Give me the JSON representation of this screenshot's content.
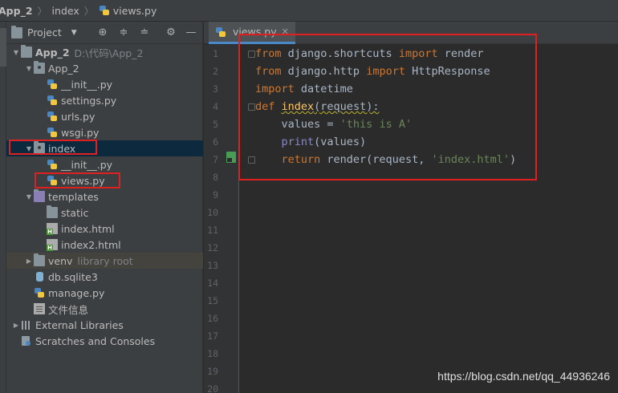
{
  "breadcrumb": {
    "items": [
      "App_2",
      "index",
      "views.py"
    ]
  },
  "project_panel": {
    "title": "Project",
    "toolbar_icons": [
      "target-icon",
      "expand-all-icon",
      "collapse-all-icon",
      "gear-icon",
      "minimize-icon"
    ]
  },
  "tree": {
    "root_name": "App_2",
    "root_path": "D:\\代码\\App_2",
    "app2_folder": "App_2",
    "app2_init": "__init__.py",
    "app2_settings": "settings.py",
    "app2_urls": "urls.py",
    "app2_wsgi": "wsgi.py",
    "index_folder": "index",
    "index_init": "__init__.py",
    "index_views": "views.py",
    "templates_folder": "templates",
    "static_folder": "static",
    "index_html": "index.html",
    "index2_html": "index2.html",
    "venv_folder": "venv",
    "venv_hint": "library root",
    "db_file": "db.sqlite3",
    "manage_file": "manage.py",
    "info_file": "文件信息",
    "external_libraries": "External Libraries",
    "scratches": "Scratches and Consoles"
  },
  "editor": {
    "tab_label": "views.py",
    "line_numbers": [
      "1",
      "2",
      "3",
      "4",
      "5",
      "6",
      "7",
      "8",
      "9",
      "10",
      "11",
      "12",
      "13",
      "14",
      "15",
      "16",
      "17",
      "18",
      "19",
      "20"
    ],
    "code": {
      "l1": {
        "kw1": "from",
        "mod": " django.shortcuts ",
        "kw2": "import",
        "name": " render"
      },
      "l2": {
        "kw1": "from",
        "mod": " django.http ",
        "kw2": "import",
        "name": " HttpResponse"
      },
      "l3": {
        "kw1": "import",
        "name": " datetime"
      },
      "l4": {
        "kw1": "def",
        "fn": "index",
        "rest": "(request):"
      },
      "l5": {
        "var": "    values = ",
        "str": "'this is A'"
      },
      "l6": {
        "bi": "    print",
        "rest": "(values)"
      },
      "l7": {
        "kw1": "    return",
        "mid": " render(request, ",
        "str": "'index.html'",
        "end": ")"
      }
    }
  },
  "watermark": "https://blog.csdn.net/qq_44936246",
  "colors": {
    "highlight_box": "#e02020",
    "keyword": "#cc7832",
    "function": "#ffc66d",
    "string": "#6a8759",
    "builtin": "#8888c6",
    "selection": "#0d293e"
  }
}
